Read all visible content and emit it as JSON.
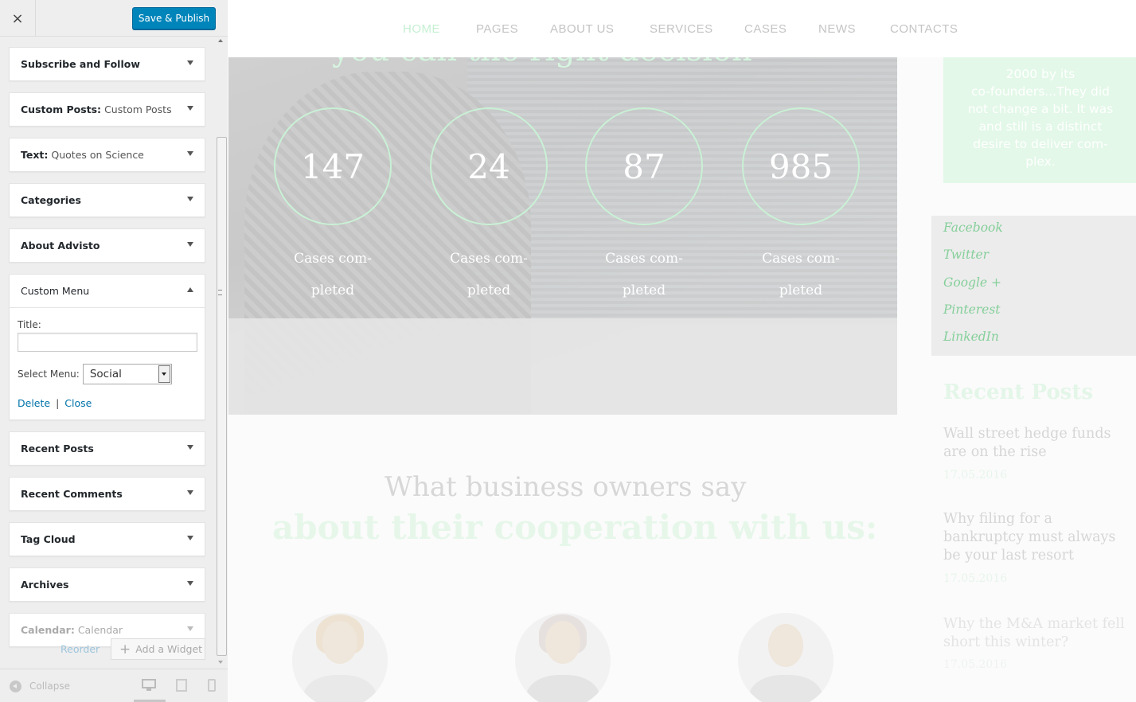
{
  "customizer": {
    "close_label": "×",
    "publish_label": "Save & Publish",
    "widgets": [
      {
        "title": "Subscribe and Follow",
        "sub": ""
      },
      {
        "title": "Custom Posts:",
        "sub": "Custom Posts"
      },
      {
        "title": "Text:",
        "sub": "Quotes on Science"
      },
      {
        "title": "Categories",
        "sub": ""
      },
      {
        "title": "About Advisto",
        "sub": ""
      }
    ],
    "open_widget": {
      "title": "Custom Menu",
      "field_title_label": "Title:",
      "field_title_value": "",
      "select_label": "Select Menu:",
      "select_value": "Social",
      "delete_label": "Delete",
      "separator": "|",
      "close_label": "Close"
    },
    "widgets_after": [
      {
        "title": "Recent Posts",
        "sub": ""
      },
      {
        "title": "Recent Comments",
        "sub": ""
      },
      {
        "title": "Tag Cloud",
        "sub": ""
      },
      {
        "title": "Archives",
        "sub": ""
      },
      {
        "title": "Calendar:",
        "sub": "Calendar"
      }
    ],
    "reorder_label": "Reorder",
    "add_widget_label": "Add a Widget",
    "collapse_label": "Collapse"
  },
  "preview": {
    "nav": [
      "HOME",
      "PAGES",
      "ABOUT US",
      "SERVICES",
      "CASES",
      "NEWS",
      "CONTACTS"
    ],
    "hero_heading": "you can the right decision",
    "stats": [
      {
        "value": "147",
        "label1": "Cases com-",
        "label2": "pleted"
      },
      {
        "value": "24",
        "label1": "Cases com-",
        "label2": "pleted"
      },
      {
        "value": "87",
        "label1": "Cases com-",
        "label2": "pleted"
      },
      {
        "value": "985",
        "label1": "Cases com-",
        "label2": "pleted"
      }
    ],
    "testimonials_title_1": "What business owners say",
    "testimonials_title_2": "about their cooperation with us:",
    "quote_lines": [
      "2000 by its",
      "co-founders...They did",
      "not change a bit. It was",
      "and still is a distinct",
      "desire to deliver com-",
      "plex."
    ],
    "social_links": [
      "Facebook",
      "Twitter",
      "Google +",
      "Pinterest",
      "LinkedIn"
    ],
    "recent_posts_title": "Recent Posts",
    "recent_posts": [
      {
        "title": "Wall street hedge funds are on the rise",
        "date": "17.05.2016"
      },
      {
        "title": "Why filing for a bankruptcy must always be your last resort",
        "date": "17.05.2016"
      },
      {
        "title": "Why the M&A market fell short this winter?",
        "date": "17.05.2016"
      }
    ]
  },
  "colors": {
    "accent": "#0085ba",
    "link": "#0073aa",
    "green_accent": "#85cf9a"
  }
}
